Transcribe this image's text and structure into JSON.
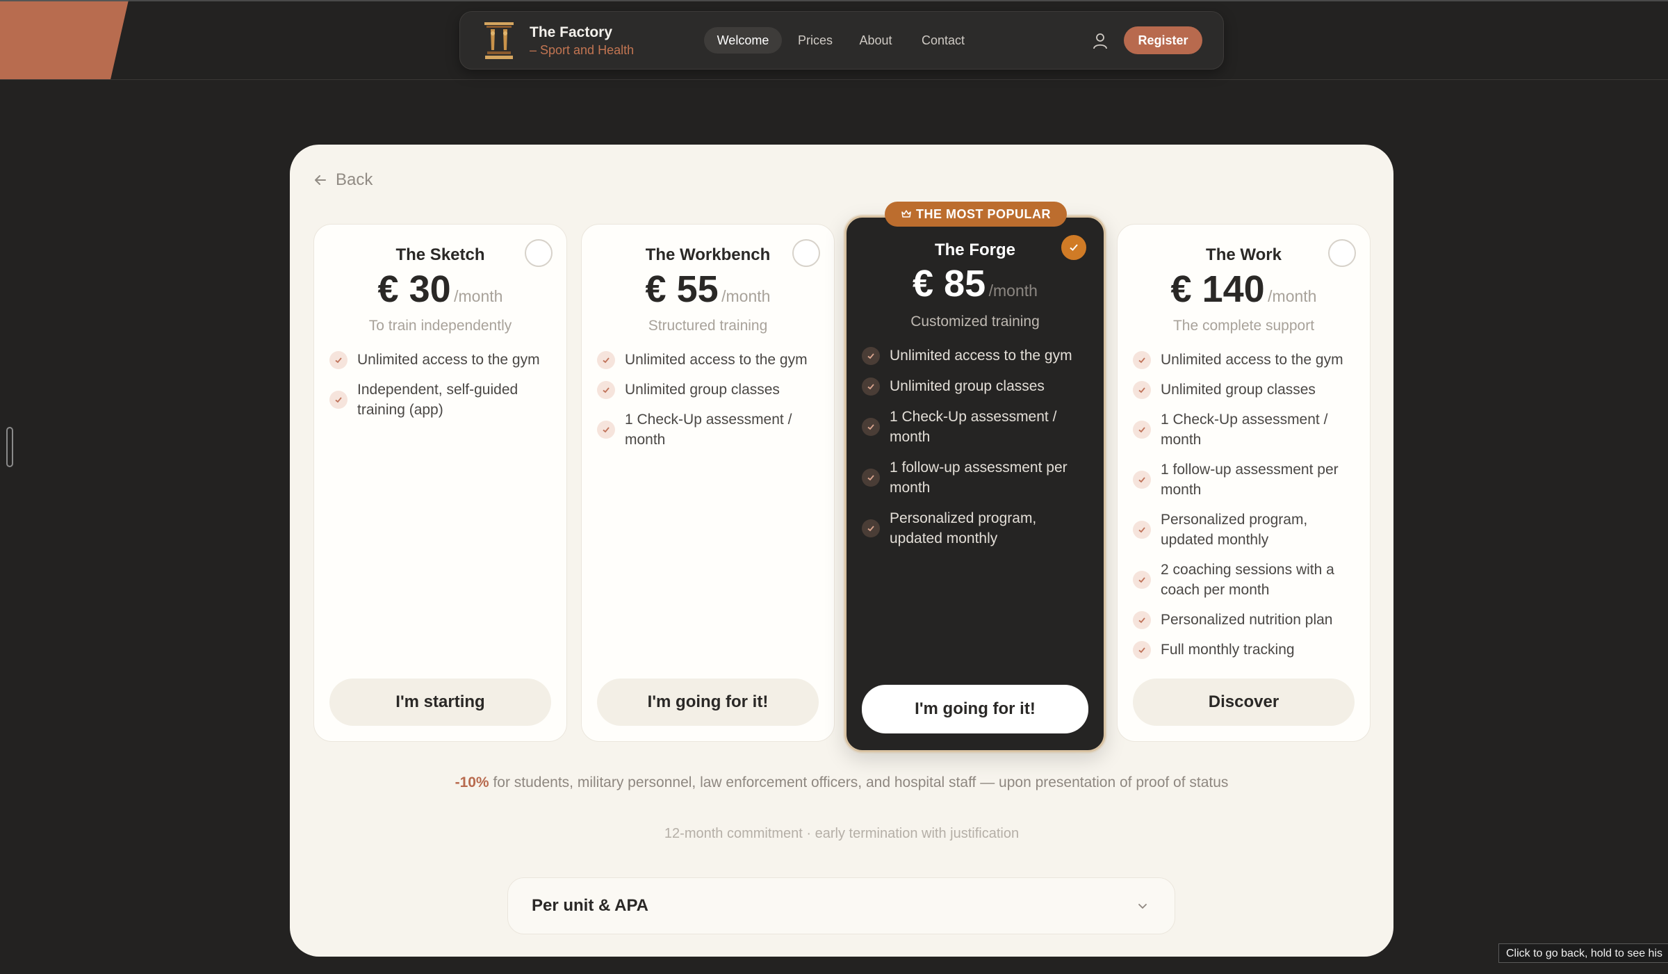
{
  "nav": {
    "brand_name": "The Factory",
    "brand_tagline": "– Sport and Health",
    "links": [
      "Welcome",
      "Prices",
      "About",
      "Contact"
    ],
    "active_link": "Welcome",
    "register_label": "Register"
  },
  "back_label": "Back",
  "plans": [
    {
      "name": "The Sketch",
      "currency": "€",
      "price": "30",
      "period": "/month",
      "subtitle": "To train independently",
      "features": [
        "Unlimited access to the gym",
        "Independent, self-guided training (app)"
      ],
      "cta": "I'm starting",
      "selected": false
    },
    {
      "name": "The Workbench",
      "currency": "€",
      "price": "55",
      "period": "/month",
      "subtitle": "Structured training",
      "features": [
        "Unlimited access to the gym",
        "Unlimited group classes",
        "1 Check-Up assessment / month"
      ],
      "cta": "I'm going for it!",
      "selected": false
    },
    {
      "name": "The Forge",
      "currency": "€",
      "price": "85",
      "period": "/month",
      "subtitle": "Customized training",
      "badge": "THE MOST POPULAR",
      "features": [
        "Unlimited access to the gym",
        "Unlimited group classes",
        "1 Check-Up assessment / month",
        "1 follow-up assessment per month",
        "Personalized program, updated monthly"
      ],
      "cta": "I'm going for it!",
      "selected": true
    },
    {
      "name": "The Work",
      "currency": "€",
      "price": "140",
      "period": "/month",
      "subtitle": "The complete support",
      "features": [
        "Unlimited access to the gym",
        "Unlimited group classes",
        "1 Check-Up assessment / month",
        "1 follow-up assessment per month",
        "Personalized program, updated monthly",
        "2 coaching sessions with a coach per month",
        "Personalized nutrition plan",
        "Full monthly tracking"
      ],
      "cta": "Discover",
      "selected": false
    }
  ],
  "discount": {
    "percent": "-10%",
    "text": "for students, military personnel, law enforcement officers, and hospital staff — upon presentation of proof of status"
  },
  "commitment": "12-month commitment · early termination with justification",
  "accordion_label": "Per unit & APA",
  "tooltip": "Click to go back, hold to see his",
  "colors": {
    "accent": "#b86a4e",
    "badge": "#bc6d2e",
    "selected_check": "#d07b26",
    "background_dark": "#232221",
    "panel": "#f7f4ed"
  },
  "icons": [
    "logo-icon",
    "user-icon",
    "arrow-left-icon",
    "check-icon",
    "crown-icon",
    "chevron-down-icon"
  ]
}
